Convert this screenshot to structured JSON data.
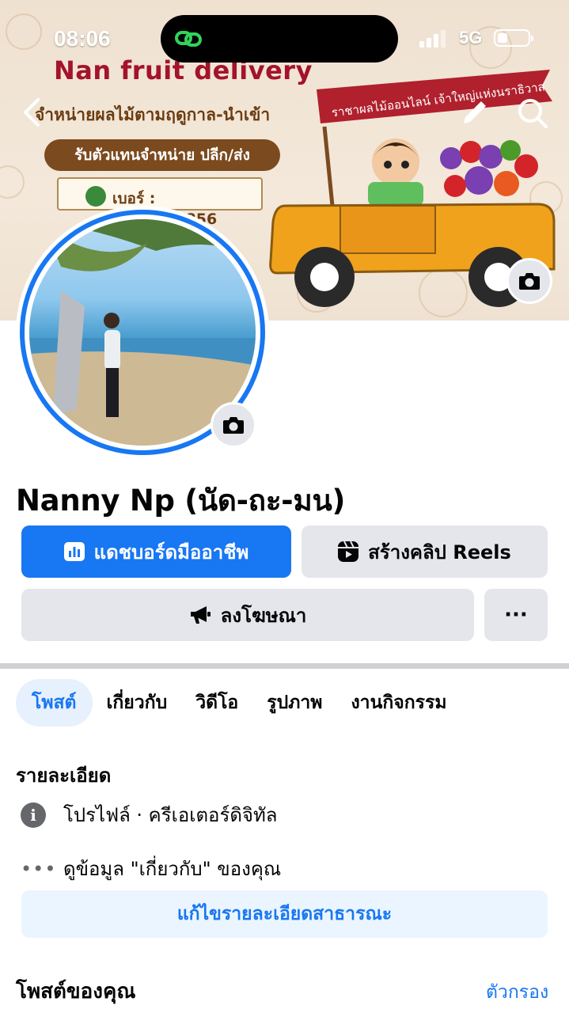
{
  "status_bar": {
    "time": "08:06",
    "network": "5G"
  },
  "cover": {
    "brand_title": "Nan fruit delivery",
    "brand_subtitle": "จำหน่ายผลไม้ตามฤดูกาล-นำเข้า",
    "pill_text": "รับตัวแทนจำหน่าย ปลีก/ส่ง",
    "phone": "เบอร์ : 0926465856",
    "banner_text": "ราชาผลไม้ออนไลน์ เจ้าใหญ่แห่งนราธิวาส"
  },
  "profile": {
    "name": "Nanny Np (นัด-ถะ-มน)"
  },
  "actions": {
    "dashboard_label": "แดชบอร์ดมืออาชีพ",
    "reels_label": "สร้างคลิป Reels",
    "ads_label": "ลงโฆษณา",
    "more_label": "···"
  },
  "tabs": [
    {
      "label": "โพสต์"
    },
    {
      "label": "เกี่ยวกับ"
    },
    {
      "label": "วิดีโอ"
    },
    {
      "label": "รูปภาพ"
    },
    {
      "label": "งานกิจกรรม"
    }
  ],
  "details": {
    "title": "รายละเอียด",
    "profile_type": "โปรไฟล์ · ครีเอเตอร์ดิจิทัล",
    "about_link": "ดูข้อมูล \"เกี่ยวกับ\" ของคุณ",
    "edit_button": "แก้ไขรายละเอียดสาธารณะ"
  },
  "posts": {
    "title": "โพสต์ของคุณ",
    "filter_label": "ตัวกรอง"
  },
  "colors": {
    "accent": "#1877f2",
    "button_gray": "#e4e6eb",
    "light_blue": "#ebf5ff"
  }
}
